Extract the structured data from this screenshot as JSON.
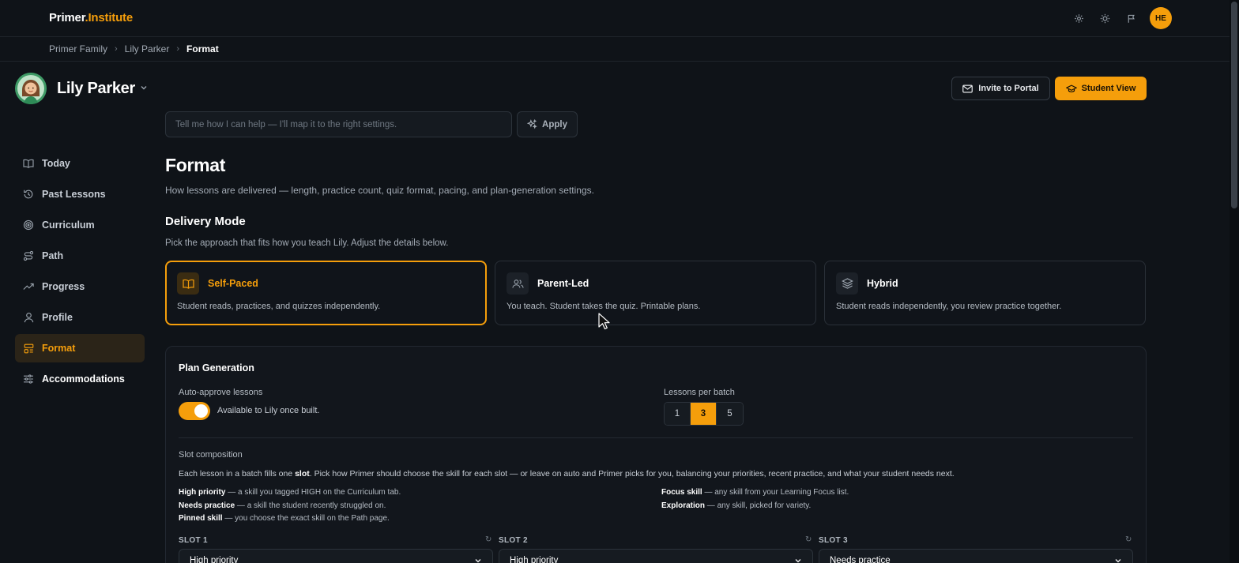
{
  "header": {
    "logo_primary": "Primer",
    "logo_secondary": ".Institute",
    "icons": [
      "gear-icon",
      "sun-icon",
      "flag-icon"
    ],
    "avatar_initials": "HE"
  },
  "breadcrumb": [
    "Primer Family",
    "Lily Parker",
    "Format"
  ],
  "student": {
    "name": "Lily Parker"
  },
  "actions": {
    "invite": "Invite to Portal",
    "student_view": "Student View"
  },
  "assistant": {
    "placeholder": "Tell me how I can help — I'll map it to the right settings.",
    "apply": "Apply"
  },
  "sidebar": {
    "items": [
      {
        "label": "Today",
        "icon": "book-icon"
      },
      {
        "label": "Past Lessons",
        "icon": "history-icon"
      },
      {
        "label": "Curriculum",
        "icon": "target-icon"
      },
      {
        "label": "Path",
        "icon": "route-icon"
      },
      {
        "label": "Progress",
        "icon": "trend-icon"
      },
      {
        "label": "Profile",
        "icon": "user-icon"
      },
      {
        "label": "Format",
        "icon": "layout-icon",
        "active": true
      },
      {
        "label": "Accommodations",
        "icon": "sliders-icon"
      }
    ]
  },
  "page": {
    "title": "Format",
    "description": "How lessons are delivered — length, practice count, quiz format, pacing, and plan-generation settings."
  },
  "delivery": {
    "title": "Delivery Mode",
    "description": "Pick the approach that fits how you teach Lily. Adjust the details below.",
    "modes": [
      {
        "name": "Self-Paced",
        "desc": "Student reads, practices, and quizzes independently.",
        "selected": true
      },
      {
        "name": "Parent-Led",
        "desc": "You teach. Student takes the quiz. Printable plans."
      },
      {
        "name": "Hybrid",
        "desc": "Student reads independently, you review practice together."
      }
    ]
  },
  "plan": {
    "title": "Plan Generation",
    "auto_approve_label": "Auto-approve lessons",
    "auto_approve_on": true,
    "auto_approve_text": "Available to Lily once built.",
    "batch_label": "Lessons per batch",
    "batch_options": [
      "1",
      "3",
      "5"
    ],
    "batch_selected": "3",
    "slot_title": "Slot composition",
    "slot_desc_1": "Each lesson in a batch fills one ",
    "slot_desc_bold": "slot",
    "slot_desc_2": ". Pick how Primer should choose the skill for each slot — or leave on auto and Primer picks for you, balancing your priorities, recent practice, and what your student needs next.",
    "legend_left": [
      {
        "term": "High priority",
        "text": " — a skill you tagged HIGH on the Curriculum tab."
      },
      {
        "term": "Needs practice",
        "text": " — a skill the student recently struggled on."
      },
      {
        "term": "Pinned skill",
        "text": " — you choose the exact skill on the Path page."
      }
    ],
    "legend_right": [
      {
        "term": "Focus skill",
        "text": " — any skill from your Learning Focus list."
      },
      {
        "term": "Exploration",
        "text": " — any skill, picked for variety."
      }
    ],
    "slots": [
      {
        "label": "SLOT 1",
        "value": "High priority"
      },
      {
        "label": "SLOT 2",
        "value": "High priority"
      },
      {
        "label": "SLOT 3",
        "value": "Needs practice"
      }
    ]
  },
  "colors": {
    "accent": "#f59e0b",
    "background": "#0f1318"
  }
}
